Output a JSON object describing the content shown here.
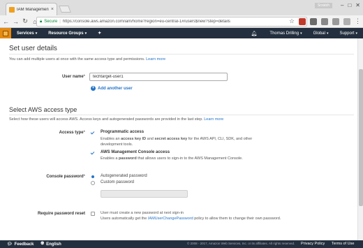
{
  "browser": {
    "tab_title": "IAM Management Conso",
    "tab_close": "×",
    "profile_label": "Scratch",
    "url_scheme_label": "Secure",
    "url": "https://console.aws.amazon.com/iam/home?region=eu-central-1#/users$new?step=details"
  },
  "aws_nav": {
    "services": "Services",
    "resource_groups": "Resource Groups",
    "user": "Thomas Drilling",
    "region": "Global",
    "support": "Support"
  },
  "set_user_details": {
    "title": "Set user details",
    "description": "You can add multiple users at once with the same access type and permissions.",
    "learn_more": "Learn more",
    "user_name_label": "User name",
    "required_mark": "*",
    "user_name_value": "techtarget-user1",
    "add_another_user": "Add another user"
  },
  "access_type": {
    "title": "Select AWS access type",
    "description": "Select how these users will access AWS. Access keys and autogenerated passwords are provided in the last step.",
    "learn_more": "Learn more",
    "label": "Access type",
    "required_mark": "*",
    "programmatic_title": "Programmatic access",
    "programmatic_desc_1": "Enables an ",
    "programmatic_desc_bold_1": "access key ID",
    "programmatic_desc_2": " and ",
    "programmatic_desc_bold_2": "secret access key",
    "programmatic_desc_3": " for the AWS API, CLI, SDK, and other development tools.",
    "programmatic_checked": true,
    "console_title": "AWS Management Console access",
    "console_desc_1": "Enables a ",
    "console_desc_bold": "password",
    "console_desc_2": " that allows users to sign-in to the AWS Management Console.",
    "console_checked": true
  },
  "console_password": {
    "label": "Console password",
    "required_mark": "*",
    "option_autogenerated": "Autogenerated password",
    "option_custom": "Custom password",
    "selected": "Autogenerated password"
  },
  "password_reset": {
    "label": "Require password reset",
    "line_1": "User must create a new password at next sign-in",
    "line_2a": "Users automatically get the ",
    "line_2_link": "IAMUserChangePassword",
    "line_2b": " policy to allow them to change their own password.",
    "checked": false
  },
  "footer": {
    "feedback": "Feedback",
    "language": "English",
    "copyright": "© 2008 - 2017, Amazon Web Services, Inc. or its affiliates. All rights reserved.",
    "privacy": "Privacy Policy",
    "terms": "Terms of Use"
  },
  "colors": {
    "aws_nav_bg": "#232f3e",
    "aws_orange": "#e58a12",
    "link_blue": "#2474c8",
    "secure_green": "#0a8a3a"
  },
  "icons": [
    "favicon-icon",
    "back-icon",
    "forward-icon",
    "reload-icon",
    "lock-icon",
    "star-icon",
    "pin-icon",
    "bell-icon",
    "plus-icon",
    "feedback-icon",
    "globe-icon"
  ]
}
